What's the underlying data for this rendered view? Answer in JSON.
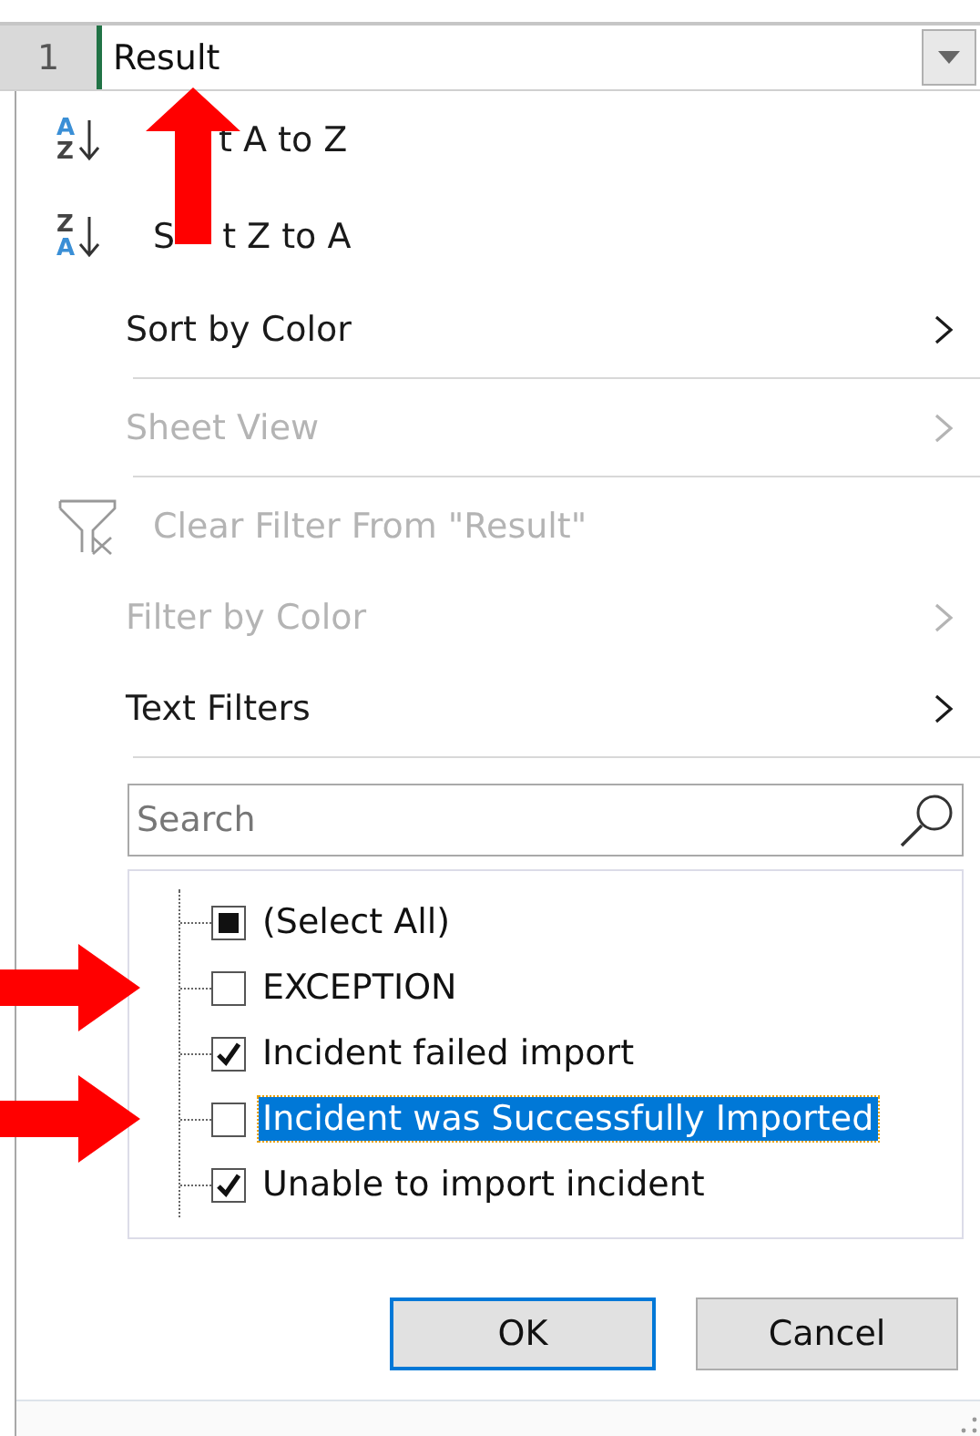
{
  "header": {
    "row_number": "1",
    "cell": "Result"
  },
  "menu": [
    {
      "kind": "sort",
      "icon_letters": [
        "A",
        "Z"
      ],
      "label": "t A to Z",
      "disabled": false,
      "arrow": true
    },
    {
      "kind": "sort",
      "icon_letters": [
        "Z",
        "A"
      ],
      "prefix": "S",
      "label": "t Z to A",
      "disabled": false,
      "arrow": false
    },
    {
      "kind": "submenu",
      "label": "Sort by Color",
      "disabled": false,
      "arrow": false
    },
    {
      "kind": "separator"
    },
    {
      "kind": "submenu",
      "label": "Sheet View",
      "disabled": true,
      "arrow": false
    },
    {
      "kind": "separator"
    },
    {
      "kind": "clear",
      "label": "Clear Filter From \"Result\"",
      "disabled": true,
      "arrow": false
    },
    {
      "kind": "submenu",
      "label": "Filter by Color",
      "disabled": true,
      "arrow": false
    },
    {
      "kind": "submenu",
      "label": "Text Filters",
      "disabled": false,
      "arrow": false
    },
    {
      "kind": "separator"
    }
  ],
  "search": {
    "placeholder": "Search"
  },
  "values": [
    {
      "label": "(Select All)",
      "checked": false,
      "indeterminate": true,
      "selected": false,
      "arrow": false
    },
    {
      "label": "EXCEPTION",
      "checked": false,
      "selected": false,
      "arrow": true
    },
    {
      "label": "Incident failed import",
      "checked": true,
      "selected": false,
      "arrow": false
    },
    {
      "label": "Incident was Successfully Imported",
      "checked": false,
      "selected": true,
      "arrow": true
    },
    {
      "label": "Unable to import incident",
      "checked": true,
      "selected": false,
      "arrow": false
    }
  ],
  "buttons": [
    {
      "label": "OK",
      "default": true
    },
    {
      "label": "Cancel",
      "default": false
    }
  ]
}
